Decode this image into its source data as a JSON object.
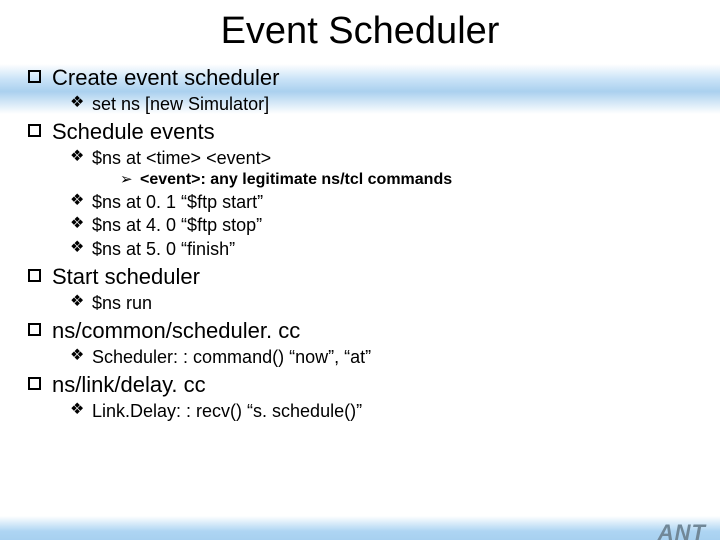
{
  "title": "Event Scheduler",
  "footer_logo": "ANT",
  "bullets": [
    {
      "text": "Create event scheduler",
      "children": [
        {
          "text": "set ns [new Simulator]"
        }
      ]
    },
    {
      "text": "Schedule events",
      "children": [
        {
          "text": "$ns at <time> <event>",
          "children": [
            {
              "text": "<event>: any legitimate ns/tcl commands"
            }
          ]
        },
        {
          "text": "$ns at 0. 1 “$ftp start”"
        },
        {
          "text": "$ns at 4. 0 “$ftp stop”"
        },
        {
          "text": "$ns at 5. 0 “finish”"
        }
      ]
    },
    {
      "text": "Start scheduler",
      "children": [
        {
          "text": "$ns run"
        }
      ]
    },
    {
      "text": "ns/common/scheduler. cc",
      "children": [
        {
          "text": "Scheduler: : command()  “now”, “at”"
        }
      ]
    },
    {
      "text": "ns/link/delay. cc",
      "children": [
        {
          "text": "Link.Delay: : recv() “s. schedule()”"
        }
      ]
    }
  ]
}
